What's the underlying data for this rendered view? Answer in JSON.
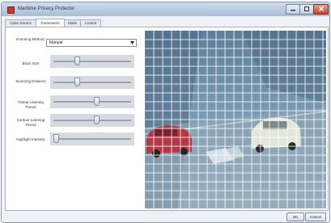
{
  "window": {
    "title": "Maritime Privacy Protector"
  },
  "tabs": [
    {
      "label": "Video Source",
      "active": false
    },
    {
      "label": "Parameters",
      "active": true
    },
    {
      "label": "Mask",
      "active": false
    },
    {
      "label": "Control",
      "active": false
    }
  ],
  "params": {
    "scanning_method": {
      "label": "Scanning Method",
      "value": "Manual"
    },
    "sliders": [
      {
        "label": "Block Size",
        "level": 0.3
      },
      {
        "label": "Scanning Distance",
        "level": 0.3
      },
      {
        "label": "Global Learning Period",
        "level": 0.55
      },
      {
        "label": "Contour Learning Period",
        "level": 0.55
      },
      {
        "label": "Highlight Intensity",
        "level": 0.03
      }
    ]
  },
  "buttons": {
    "ok": "OK",
    "cancel": "Cancel"
  },
  "colors": {
    "accent": "#c8392b",
    "titlebar": "#a9bdd6",
    "grid": "#ffffff"
  }
}
